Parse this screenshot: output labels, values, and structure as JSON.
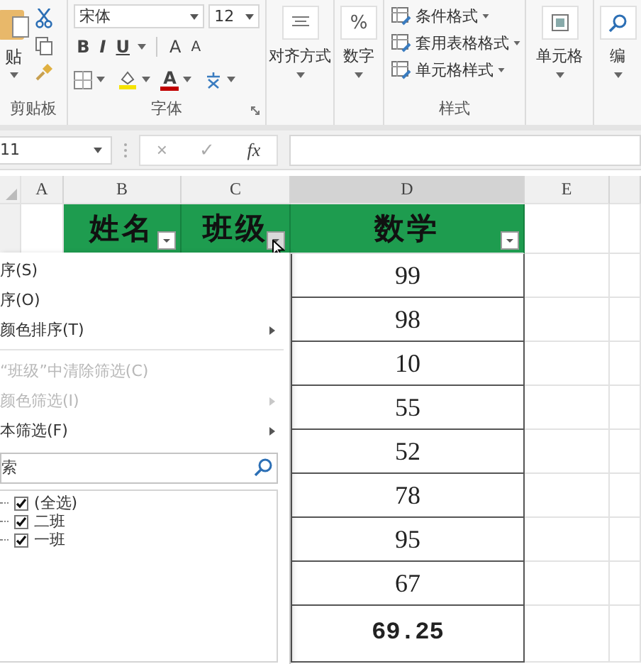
{
  "ribbon": {
    "clipboard": {
      "paste_label": "贴",
      "group_label": "剪贴板"
    },
    "font": {
      "name": "宋体",
      "size": "12",
      "bold": "B",
      "italic": "I",
      "underline": "U",
      "grow": "A",
      "shrink": "A",
      "font_color": "A",
      "group_label": "字体"
    },
    "alignment": {
      "label": "对齐方式"
    },
    "number": {
      "symbol": "%",
      "label": "数字"
    },
    "styles": {
      "items": [
        "条件格式",
        "套用表格格式",
        "单元格样式"
      ],
      "group_label": "样式"
    },
    "cells": {
      "label": "单元格"
    },
    "editing": {
      "label": "编"
    }
  },
  "formula_bar": {
    "name_box": "11",
    "cancel": "×",
    "enter": "✓",
    "function": "fx"
  },
  "sheet": {
    "columns": [
      "A",
      "B",
      "C",
      "D",
      "E"
    ],
    "headers": [
      {
        "text": "姓名",
        "filter_active": false
      },
      {
        "text": "班级",
        "filter_active": true
      },
      {
        "text": "数学",
        "filter_active": false
      }
    ],
    "math_scores": [
      "99",
      "98",
      "10",
      "55",
      "52",
      "78",
      "95",
      "67"
    ],
    "average": "69.25"
  },
  "filter_menu": {
    "items": [
      {
        "kind": "item",
        "label": "序(S)",
        "disabled": false,
        "submenu": false
      },
      {
        "kind": "item",
        "label": "序(O)",
        "disabled": false,
        "submenu": false
      },
      {
        "kind": "item",
        "label": "颜色排序(T)",
        "disabled": false,
        "submenu": true
      },
      {
        "kind": "separator"
      },
      {
        "kind": "item",
        "label": "“班级”中清除筛选(C)",
        "disabled": true,
        "submenu": false
      },
      {
        "kind": "item",
        "label": "颜色筛选(I)",
        "disabled": true,
        "submenu": true
      },
      {
        "kind": "item",
        "label": "本筛选(F)",
        "disabled": false,
        "submenu": true
      }
    ],
    "search_placeholder": "索",
    "values": [
      {
        "label": "(全选)",
        "checked": true
      },
      {
        "label": "二班",
        "checked": true
      },
      {
        "label": "一班",
        "checked": true
      }
    ]
  }
}
